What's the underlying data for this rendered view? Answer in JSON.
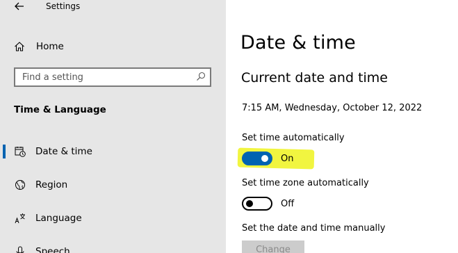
{
  "window": {
    "title": "Settings"
  },
  "sidebar": {
    "home_label": "Home",
    "search_placeholder": "Find a setting",
    "section_header": "Time & Language",
    "items": [
      {
        "label": "Date & time",
        "icon": "calendar-clock-icon",
        "selected": true
      },
      {
        "label": "Region",
        "icon": "globe-icon",
        "selected": false
      },
      {
        "label": "Language",
        "icon": "language-icon",
        "selected": false
      },
      {
        "label": "Speech",
        "icon": "microphone-icon",
        "selected": false
      }
    ]
  },
  "main": {
    "page_title": "Date & time",
    "section_title": "Current date and time",
    "current_datetime": "7:15 AM, Wednesday, October 12, 2022",
    "set_time_auto": {
      "label": "Set time automatically",
      "state": "On",
      "on": true
    },
    "set_timezone_auto": {
      "label": "Set time zone automatically",
      "state": "Off",
      "on": false
    },
    "manual": {
      "label": "Set the date and time manually",
      "button_label": "Change"
    }
  },
  "colors": {
    "sidebar_bg": "#e6e6e6",
    "accent": "#0063b1",
    "highlight": "#ecf200"
  }
}
